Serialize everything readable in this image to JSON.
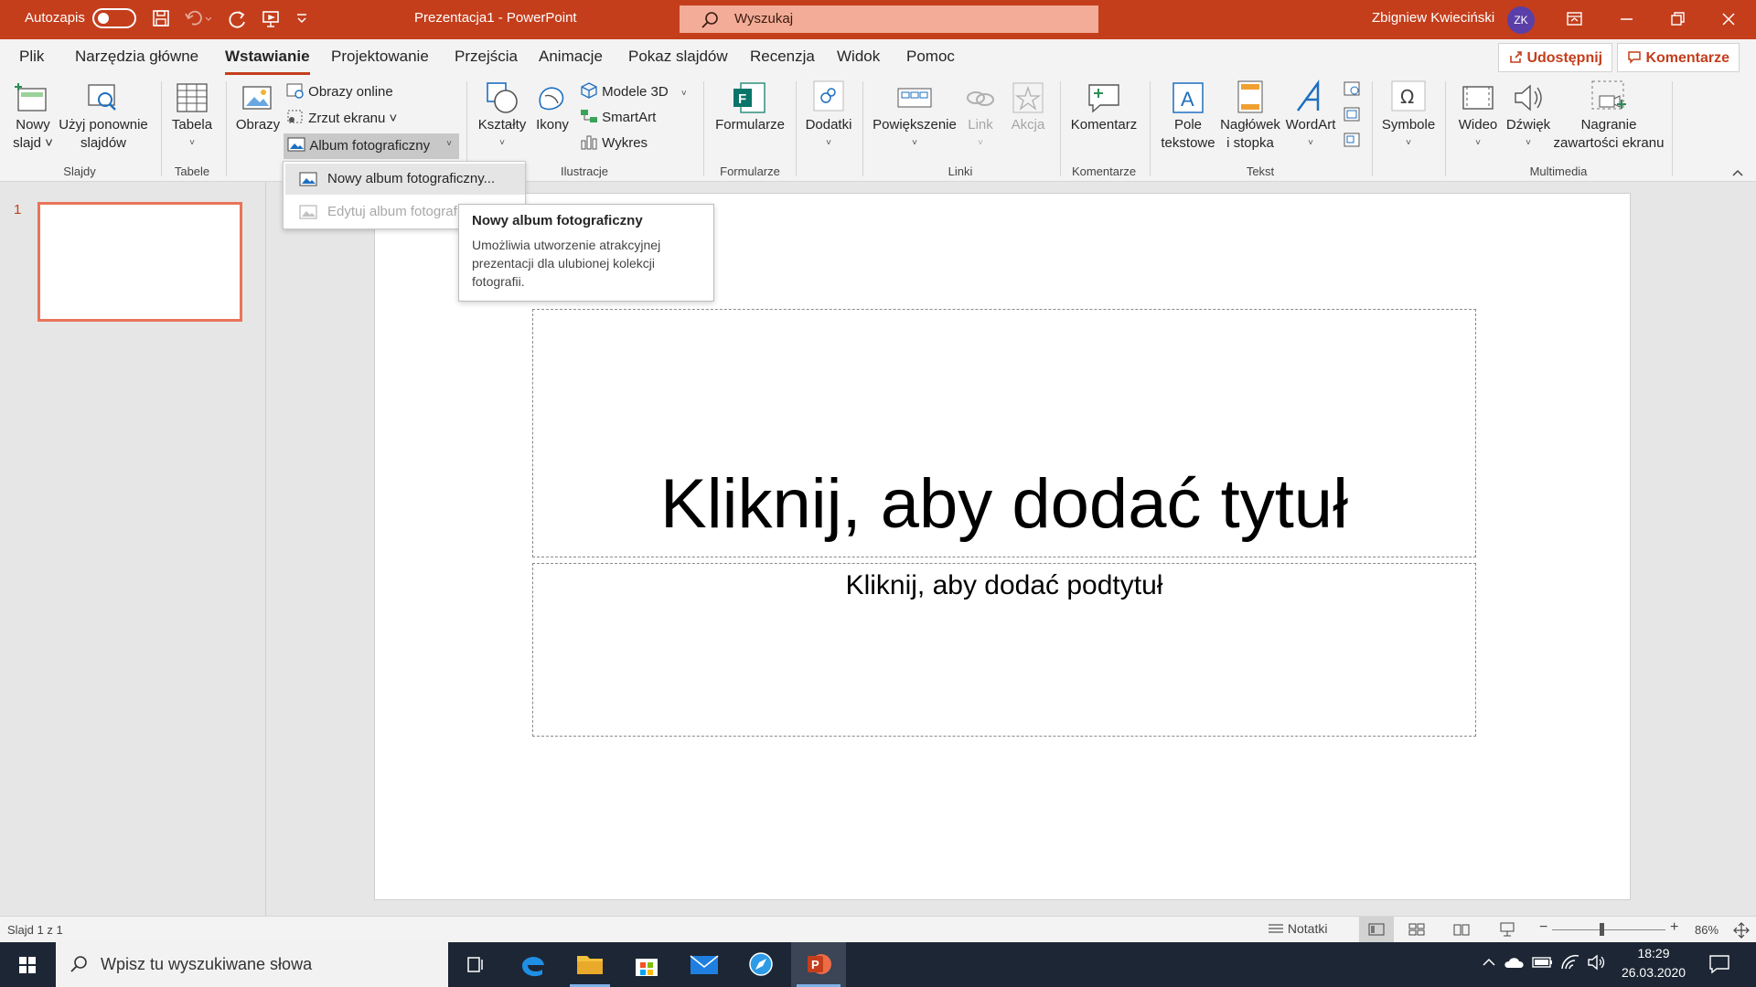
{
  "titlebar": {
    "autosave_label": "Autozapis",
    "doc_title": "Prezentacja1  -  PowerPoint",
    "search_placeholder": "Wyszukaj",
    "user_name": "Zbigniew Kwieciński",
    "user_initials": "ZK"
  },
  "tabs": [
    "Plik",
    "Narzędzia główne",
    "Wstawianie",
    "Projektowanie",
    "Przejścia",
    "Animacje",
    "Pokaz slajdów",
    "Recenzja",
    "Widok",
    "Pomoc"
  ],
  "active_tab": "Wstawianie",
  "share": {
    "share_label": "Udostępnij",
    "comments_label": "Komentarze"
  },
  "ribbon": {
    "new_slide": [
      "Nowy",
      "slajd ˅"
    ],
    "reuse_slides": [
      "Użyj ponownie",
      "slajdów"
    ],
    "table": "Tabela",
    "pictures": "Obrazy",
    "online_pictures": "Obrazy online",
    "screenshot": "Zrzut ekranu ˅",
    "photo_album": "Album fotograficzny",
    "shapes": "Kształty",
    "icons": "Ikony",
    "models3d": "Modele 3D",
    "smartart": "SmartArt",
    "chart": "Wykres",
    "forms": "Formularze",
    "addins": "Dodatki",
    "zoom": "Powiększenie",
    "link": "Link",
    "action": "Akcja",
    "comment": "Komentarz",
    "textbox": [
      "Pole",
      "tekstowe"
    ],
    "header_footer": [
      "Nagłówek",
      "i stopka"
    ],
    "wordart": "WordArt",
    "symbols": "Symbole",
    "video": "Wideo",
    "audio": "Dźwięk",
    "screen_recording": [
      "Nagranie",
      "zawartości ekranu"
    ],
    "groups": {
      "slides": "Slajdy",
      "tables": "Tabele",
      "illustrations": "Ilustracje",
      "forms": "Formularze",
      "links": "Linki",
      "comments": "Komentarze",
      "text": "Tekst",
      "media": "Multimedia"
    }
  },
  "dropdown": {
    "new_album": "Nowy album fotograficzny...",
    "edit_album": "Edytuj album fotograf"
  },
  "tooltip": {
    "title": "Nowy album fotograficzny",
    "lines": [
      "Umożliwia utworzenie atrakcyjnej",
      "prezentacji dla ulubionej kolekcji",
      "fotografii."
    ]
  },
  "thumbs": {
    "slide_number": "1"
  },
  "slide": {
    "title_placeholder": "Kliknij, aby dodać tytuł",
    "subtitle_placeholder": "Kliknij, aby dodać podtytuł"
  },
  "status": {
    "slide_counter": "Slajd 1 z 1",
    "notes_label": "Notatki",
    "zoom_percent": "86%",
    "zoom_level": 0.86
  },
  "taskbar": {
    "search_placeholder": "Wpisz tu wyszukiwane słowa",
    "time": "18:29",
    "date": "26.03.2020"
  },
  "colors": {
    "accent": "#c43e1c",
    "title_bar": "#c43e1c",
    "search_box": "#f2ac97",
    "thumb_border": "#e9745a",
    "taskbar": "#1d2634"
  }
}
